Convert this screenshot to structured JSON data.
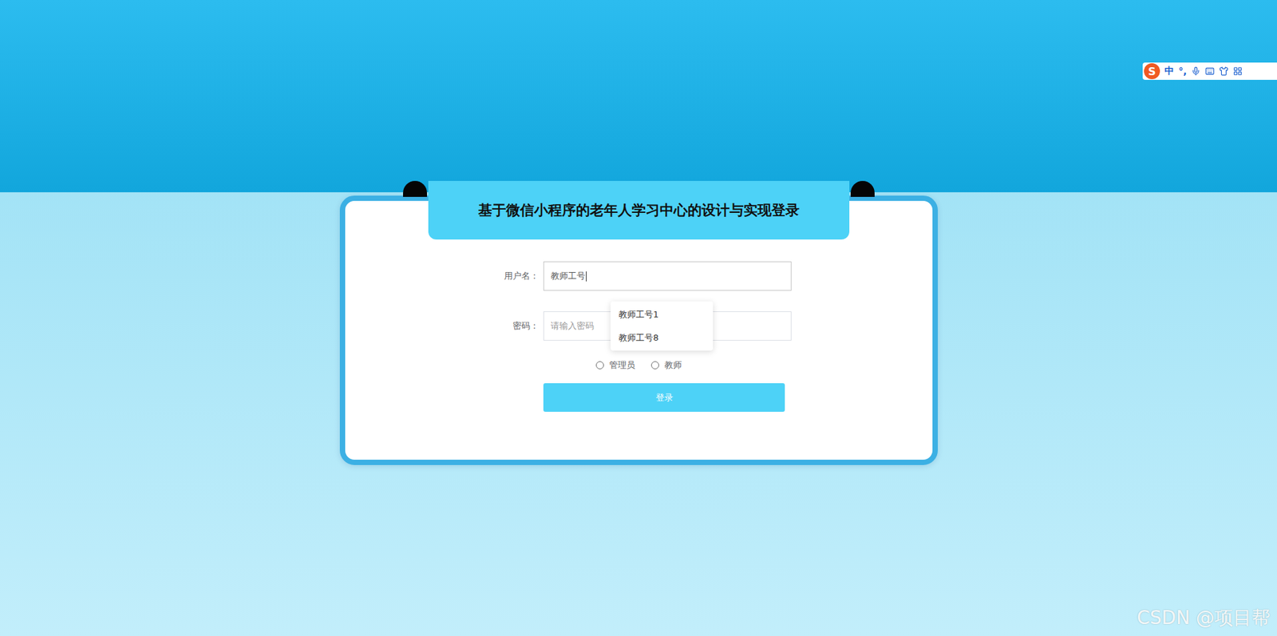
{
  "ime_toolbar": {
    "logo": "S",
    "items": [
      "中",
      "°,"
    ]
  },
  "login": {
    "title": "基于微信小程序的老年人学习中心的设计与实现登录",
    "fields": [
      {
        "label": "用户名：",
        "value": "教师工号",
        "placeholder": "",
        "focused": true
      },
      {
        "label": "密码：",
        "value": "",
        "placeholder": "请输入密码",
        "focused": false
      }
    ],
    "autocomplete": [
      "教师工号1",
      "教师工号8"
    ],
    "roles": [
      {
        "label": "管理员",
        "selected": false
      },
      {
        "label": "教师",
        "selected": false
      }
    ],
    "button": "登录"
  },
  "watermark": "CSDN @项目帮"
}
